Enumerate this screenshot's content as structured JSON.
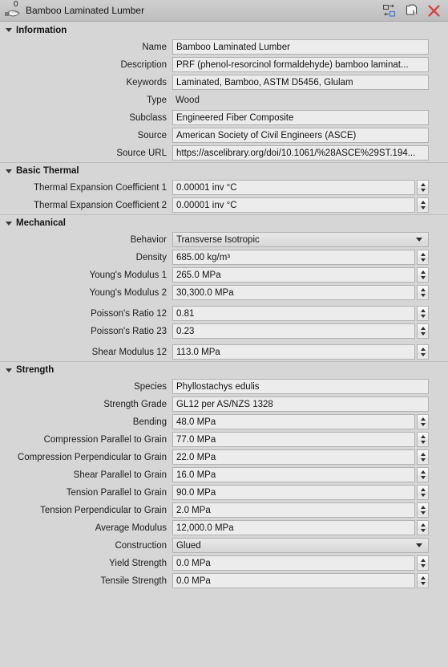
{
  "titlebar": {
    "badge": "0",
    "title": "Bamboo Laminated Lumber",
    "buttons": [
      {
        "name": "swap-icon",
        "tip": "Swap"
      },
      {
        "name": "copy-icon",
        "tip": "Copy"
      },
      {
        "name": "close-icon",
        "tip": "Close"
      }
    ]
  },
  "sections": [
    {
      "title": "Information",
      "rows": [
        {
          "label": "Name",
          "value": "Bamboo Laminated Lumber",
          "type": "text"
        },
        {
          "label": "Description",
          "value": "PRF (phenol-resorcinol formaldehyde) bamboo laminat...",
          "type": "text"
        },
        {
          "label": "Keywords",
          "value": "Laminated, Bamboo, ASTM D5456, Glulam",
          "type": "text"
        },
        {
          "label": "Type",
          "value": "Wood",
          "type": "static"
        },
        {
          "label": "Subclass",
          "value": "Engineered Fiber Composite",
          "type": "text"
        },
        {
          "label": "Source",
          "value": "American Society of Civil Engineers (ASCE)",
          "type": "text"
        },
        {
          "label": "Source URL",
          "value": "https://ascelibrary.org/doi/10.1061/%28ASCE%29ST.194...",
          "type": "text"
        }
      ]
    },
    {
      "title": "Basic Thermal",
      "rows": [
        {
          "label": "Thermal Expansion Coefficient 1",
          "value": "0.00001 inv °C",
          "type": "spin"
        },
        {
          "label": "Thermal Expansion Coefficient 2",
          "value": "0.00001 inv °C",
          "type": "spin"
        }
      ]
    },
    {
      "title": "Mechanical",
      "rows": [
        {
          "label": "Behavior",
          "value": "Transverse Isotropic",
          "type": "combo"
        },
        {
          "label": "Density",
          "value": "685.00 kg/m³",
          "type": "spin"
        },
        {
          "label": "Young's Modulus 1",
          "value": "265.0 MPa",
          "type": "spin"
        },
        {
          "label": "Young's Modulus 2",
          "value": "30,300.0 MPa",
          "type": "spin"
        },
        {
          "label": "Poisson's Ratio 12",
          "value": "0.81",
          "type": "spin",
          "gap": true
        },
        {
          "label": "Poisson's Ratio 23",
          "value": "0.23",
          "type": "spin"
        },
        {
          "label": "Shear Modulus 12",
          "value": "113.0 MPa",
          "type": "spin",
          "gap": true
        }
      ]
    },
    {
      "title": "Strength",
      "rows": [
        {
          "label": "Species",
          "value": "Phyllostachys edulis",
          "type": "text"
        },
        {
          "label": "Strength Grade",
          "value": "GL12 per AS/NZS 1328",
          "type": "text"
        },
        {
          "label": "Bending",
          "value": "48.0 MPa",
          "type": "spin"
        },
        {
          "label": "Compression Parallel to Grain",
          "value": "77.0 MPa",
          "type": "spin"
        },
        {
          "label": "Compression Perpendicular to Grain",
          "value": "22.0 MPa",
          "type": "spin"
        },
        {
          "label": "Shear Parallel to Grain",
          "value": "16.0 MPa",
          "type": "spin"
        },
        {
          "label": "Tension Parallel to Grain",
          "value": "90.0 MPa",
          "type": "spin"
        },
        {
          "label": "Tension Perpendicular to Grain",
          "value": "2.0 MPa",
          "type": "spin"
        },
        {
          "label": "Average Modulus",
          "value": "12,000.0 MPa",
          "type": "spin"
        },
        {
          "label": "Construction",
          "value": "Glued",
          "type": "combo"
        },
        {
          "label": "Yield Strength",
          "value": "0.0 MPa",
          "type": "spin"
        },
        {
          "label": "Tensile Strength",
          "value": "0.0 MPa",
          "type": "spin"
        }
      ]
    }
  ],
  "colors": {
    "window_bg": "#d6d6d6",
    "titlebar_bg": "#c6c6c6",
    "field_bg": "#ececec",
    "field_border": "#b2b2b2",
    "close_red": "#d94040",
    "accent_blue": "#3b7fd4"
  }
}
